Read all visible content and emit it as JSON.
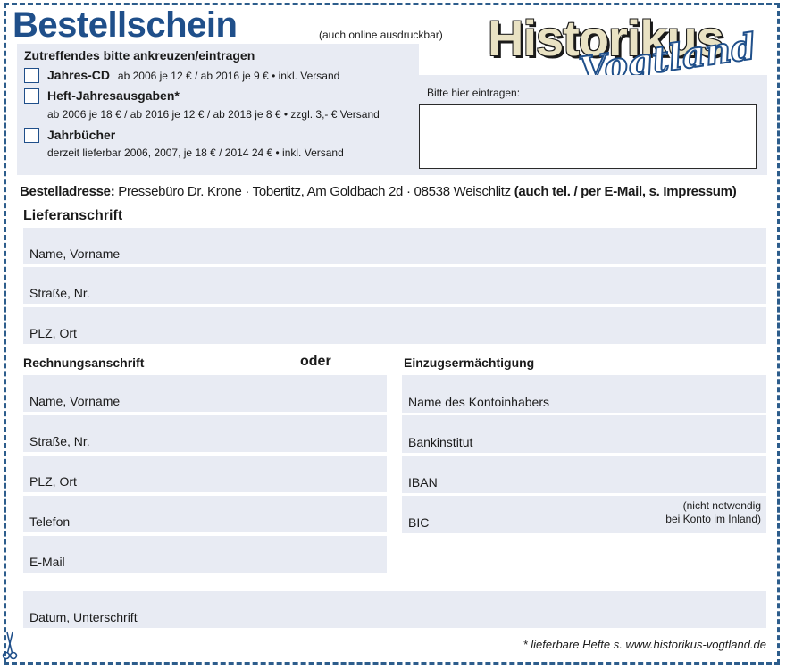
{
  "header": {
    "title": "Bestellschein",
    "subtitle": "(auch online ausdruckbar)",
    "logo_main": "Historikus",
    "logo_sub": "Vogtland"
  },
  "selection": {
    "title": "Zutreffendes bitte ankreuzen/eintragen",
    "options": [
      {
        "label": "Jahres-CD",
        "detail": "ab 2006 je 12 € / ab 2016 je 9 € • inkl. Versand"
      },
      {
        "label": "Heft-Jahresausgaben*",
        "detail": "ab 2006 je 18 € / ab 2016 je 12 € / ab 2018 je 8 € • zzgl. 3,- € Versand"
      },
      {
        "label": "Jahrbücher",
        "detail": "derzeit lieferbar 2006, 2007, je 18 € / 2014 24 € • inkl. Versand"
      }
    ],
    "entry_hint": "Bitte hier eintragen:"
  },
  "order_address": {
    "label": "Bestelladresse:",
    "text": "Pressebüro Dr. Krone · Tobertitz, Am Goldbach 2d · 08538 Weischlitz",
    "suffix": "(auch tel. / per E-Mail, s. Impressum)"
  },
  "delivery": {
    "title": "Lieferanschrift",
    "fields": [
      "Name, Vorname",
      "Straße, Nr.",
      "PLZ, Ort"
    ]
  },
  "billing": {
    "title": "Rechnungsanschrift",
    "fields": [
      "Name, Vorname",
      "Straße, Nr.",
      "PLZ, Ort",
      "Telefon",
      "E-Mail"
    ]
  },
  "or_label": "oder",
  "debit": {
    "title": "Einzugsermächtigung",
    "fields": [
      "Name des Kontoinhabers",
      "Bankinstitut",
      "IBAN",
      "BIC"
    ],
    "bic_note_1": "(nicht notwendig",
    "bic_note_2": "bei Konto im Inland)"
  },
  "signature": {
    "label": "Datum, Unterschrift"
  },
  "footnote": "* lieferbare Hefte s. www.historikus-vogtland.de",
  "colors": {
    "accent": "#1f4f8a",
    "field_bg": "#e8ebf3",
    "logo_fill": "#e9e2c3"
  },
  "icons": {
    "cut_marker": "scissors-icon"
  }
}
